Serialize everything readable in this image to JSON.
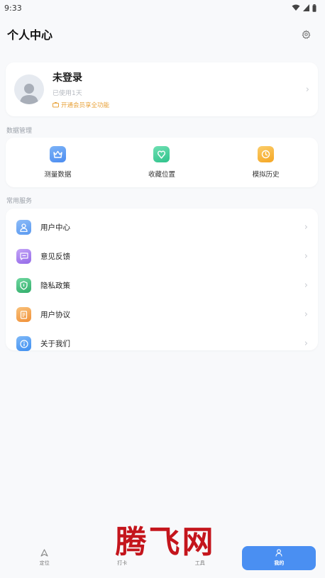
{
  "status": {
    "time": "9:33"
  },
  "header": {
    "title": "个人中心",
    "settings_icon": "gear-icon"
  },
  "profile": {
    "name": "未登录",
    "usage": "已使用1天",
    "vip": "开通会员享全功能",
    "vip_color": "#e8a23a"
  },
  "data_section": {
    "label": "数据管理",
    "items": [
      {
        "label": "测量数据",
        "icon": "crown-icon",
        "color": "#5b9cf2"
      },
      {
        "label": "收藏位置",
        "icon": "location-heart-icon",
        "color": "#3fcf9a"
      },
      {
        "label": "模拟历史",
        "icon": "clock-icon",
        "color": "#f6b23c"
      }
    ]
  },
  "services": {
    "label": "常用服务",
    "items": [
      {
        "label": "用户中心",
        "icon": "user-icon",
        "color": "#6aa7f5"
      },
      {
        "label": "意见反馈",
        "icon": "feedback-icon",
        "color": "#a77cf0"
      },
      {
        "label": "隐私政策",
        "icon": "shield-icon",
        "color": "#3dbb7a"
      },
      {
        "label": "用户协议",
        "icon": "document-icon",
        "color": "#f5a14a"
      },
      {
        "label": "关于我们",
        "icon": "info-icon",
        "color": "#4c9ef5"
      }
    ]
  },
  "tabbar": {
    "items": [
      {
        "label": "定位",
        "icon": "navigate-icon"
      },
      {
        "label": "打卡",
        "icon": "checkin-icon"
      },
      {
        "label": "工具",
        "icon": "tools-icon"
      },
      {
        "label": "我的",
        "icon": "person-icon",
        "active": true
      }
    ],
    "active_color": "#4a8ff2"
  },
  "watermark": "腾飞网"
}
